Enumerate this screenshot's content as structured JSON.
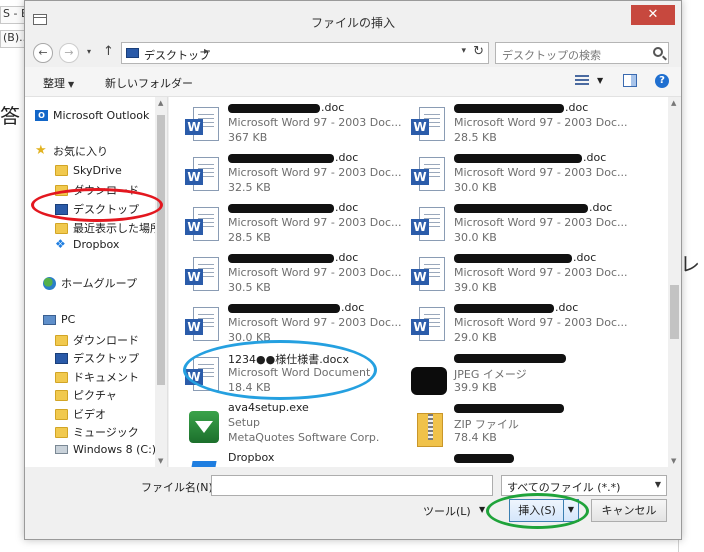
{
  "background": {
    "strip1": "S - Ex",
    "strip2": "(B)...",
    "big_char": "答",
    "right_char": "レ"
  },
  "dialog": {
    "title": "ファイルの挿入",
    "close": "✕"
  },
  "nav": {
    "back": "←",
    "forward": "→",
    "dropdown": "▾",
    "up": "↑",
    "path": "デスクトップ",
    "path_arrow": "▸",
    "refresh": "↻",
    "search_placeholder": "デスクトップの検索"
  },
  "toolbar": {
    "organize": "整理",
    "new_folder": "新しいフォルダー",
    "help": "?"
  },
  "navpane": {
    "items": [
      {
        "label": "Microsoft Outlook",
        "icon": "outlook-icon"
      },
      {
        "label": "お気に入り",
        "icon": "star-icon"
      },
      {
        "label": "SkyDrive",
        "icon": "folder-icon"
      },
      {
        "label": "ダウンロード",
        "icon": "folder-icon"
      },
      {
        "label": "デスクトップ",
        "icon": "desktop-icon"
      },
      {
        "label": "最近表示した場所",
        "icon": "folder-icon"
      },
      {
        "label": "Dropbox",
        "icon": "dropbox-icon"
      },
      {
        "label": "ホームグループ",
        "icon": "homegroup-icon"
      },
      {
        "label": "PC",
        "icon": "pc-icon"
      },
      {
        "label": "ダウンロード",
        "icon": "folder-icon"
      },
      {
        "label": "デスクトップ",
        "icon": "desktop-icon"
      },
      {
        "label": "ドキュメント",
        "icon": "folder-icon"
      },
      {
        "label": "ピクチャ",
        "icon": "folder-icon"
      },
      {
        "label": "ビデオ",
        "icon": "folder-icon"
      },
      {
        "label": "ミュージック",
        "icon": "folder-icon"
      },
      {
        "label": "Windows 8 (C:)",
        "icon": "drive-icon"
      }
    ]
  },
  "files": [
    {
      "name": ".doc",
      "type": "Microsoft Word 97 - 2003 Doc...",
      "size": "367 KB",
      "icon": "word-icon",
      "redacted": true
    },
    {
      "name": ".doc",
      "type": "Microsoft Word 97 - 2003 Doc...",
      "size": "28.5 KB",
      "icon": "word-icon",
      "redacted": true
    },
    {
      "name": ".doc",
      "type": "Microsoft Word 97 - 2003 Doc...",
      "size": "32.5 KB",
      "icon": "word-icon",
      "redacted": true
    },
    {
      "name": ".doc",
      "type": "Microsoft Word 97 - 2003 Doc...",
      "size": "30.0 KB",
      "icon": "word-icon",
      "redacted": true
    },
    {
      "name": ".doc",
      "type": "Microsoft Word 97 - 2003 Doc...",
      "size": "28.5 KB",
      "icon": "word-icon",
      "redacted": true
    },
    {
      "name": ".doc",
      "type": "Microsoft Word 97 - 2003 Doc...",
      "size": "30.0 KB",
      "icon": "word-icon",
      "redacted": true
    },
    {
      "name": ".doc",
      "type": "Microsoft Word 97 - 2003 Doc...",
      "size": "30.5 KB",
      "icon": "word-icon",
      "redacted": true
    },
    {
      "name": ".doc",
      "type": "Microsoft Word 97 - 2003 Doc...",
      "size": "39.0 KB",
      "icon": "word-icon",
      "redacted": true
    },
    {
      "name": ".doc",
      "type": "Microsoft Word 97 - 2003 Doc...",
      "size": "30.0 KB",
      "icon": "word-icon",
      "redacted": true
    },
    {
      "name": ".doc",
      "type": "Microsoft Word 97 - 2003 Doc...",
      "size": "29.0 KB",
      "icon": "word-icon",
      "redacted": true
    },
    {
      "name": "1234●●様仕様書.docx",
      "type": "Microsoft Word Document",
      "size": "18.4 KB",
      "icon": "word-icon",
      "redacted": false
    },
    {
      "name": "",
      "type": "JPEG イメージ",
      "size": "39.9 KB",
      "icon": "image-icon",
      "redacted": true
    },
    {
      "name": "ava4setup.exe",
      "type": "Setup",
      "size": "MetaQuotes Software Corp.",
      "icon": "setup-icon",
      "redacted": false
    },
    {
      "name": "",
      "type": "ZIP ファイル",
      "size": "78.4 KB",
      "icon": "zip-icon",
      "redacted": true
    },
    {
      "name": "Dropbox",
      "type": "",
      "size": "",
      "icon": "dropbox-icon",
      "redacted": false
    }
  ],
  "bottom": {
    "filename_label": "ファイル名(N):",
    "filename_value": "",
    "filetype": "すべてのファイル (*.*)",
    "tools": "ツール(L)",
    "insert": "挿入(S)",
    "cancel": "キャンセル"
  },
  "colors": {
    "annotation_red": "#e3171f",
    "annotation_blue": "#25a0e0",
    "annotation_green": "#1fa33a",
    "close_button": "#c7483e"
  }
}
